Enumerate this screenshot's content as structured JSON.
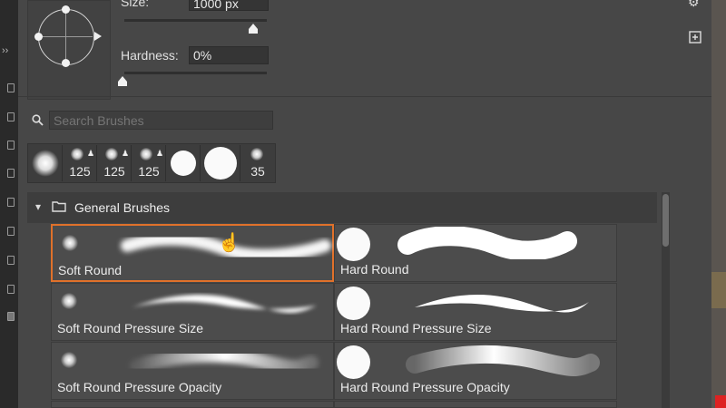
{
  "brush_settings": {
    "size_label": "Size:",
    "size_value": "1000 px",
    "hardness_label": "Hardness:",
    "hardness_value": "0%"
  },
  "search": {
    "placeholder": "Search Brushes"
  },
  "presets": [
    {
      "num": ""
    },
    {
      "num": "125"
    },
    {
      "num": "125"
    },
    {
      "num": "125"
    },
    {
      "num": ""
    },
    {
      "num": ""
    },
    {
      "num": "35"
    }
  ],
  "group": {
    "title": "General Brushes"
  },
  "brushes": [
    {
      "label": "Soft Round"
    },
    {
      "label": "Hard Round"
    },
    {
      "label": "Soft Round Pressure Size"
    },
    {
      "label": "Hard Round Pressure Size"
    },
    {
      "label": "Soft Round Pressure Opacity"
    },
    {
      "label": "Hard Round Pressure Opacity"
    }
  ],
  "colors": {
    "selection": "#e0712a",
    "panel": "#474747"
  },
  "icons": [
    "search-icon",
    "folder-icon",
    "chevron-down-icon",
    "gear-icon",
    "new-brush-icon",
    "hand-cursor-icon"
  ]
}
